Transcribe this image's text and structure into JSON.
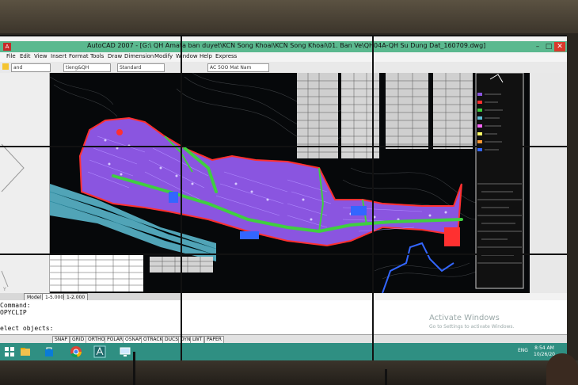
{
  "window": {
    "title": "AutoCAD 2007 - [G:\\ QH Amata ban duyet\\KCN Song Khoai\\KCN Song Khoai\\01. Ban Ve\\QH04A-QH Su Dung Dat_160709.dwg]",
    "controls": [
      "–",
      "□",
      "✕"
    ]
  },
  "menu": {
    "items": [
      "File",
      "Edit",
      "View",
      "Insert",
      "Format",
      "Tools",
      "Draw",
      "Dimension",
      "Modify",
      "Window",
      "Help",
      "Express"
    ]
  },
  "toolbar": {
    "fields": [
      "and",
      "tieng&QH",
      "Standard",
      "AC 5OO Mat Nam"
    ]
  },
  "layout_tabs": [
    "Model",
    "1-5.000",
    "1-2.000"
  ],
  "command_line": {
    "lines": [
      "Command:",
      "OPYCLIP",
      "",
      "elect objects:"
    ]
  },
  "watermark": {
    "title": "Activate Windows",
    "subtitle": "Go to Settings to activate Windows."
  },
  "status_bar": {
    "buttons": [
      "SNAP",
      "GRID",
      "ORTHO",
      "POLAR",
      "OSNAP",
      "OTRACK",
      "DUCS",
      "DYN",
      "LWT",
      "PAPER"
    ]
  },
  "taskbar": {
    "apps": [
      "windows-start-icon",
      "file-explorer-icon",
      "store-icon",
      "chrome-icon",
      "autocad-icon",
      "desktop-icon"
    ],
    "language": "ENG",
    "time": "8:54 AM",
    "date": "10/26/20"
  },
  "colors": {
    "title_bar": "#5bb98f",
    "taskbar": "#2f8f82",
    "drawing_bg": "#06080a",
    "landuse_purple": "#8a55e0",
    "road_green": "#3fcf3f",
    "water": "#5fbfd6",
    "boundary_red": "#ff3030"
  }
}
